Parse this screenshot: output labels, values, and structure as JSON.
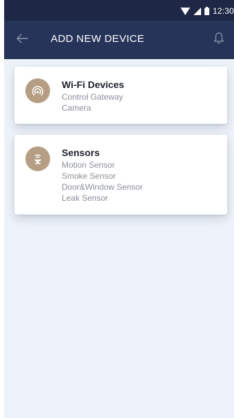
{
  "status_bar": {
    "time": "12:30",
    "icons": [
      "wifi-icon",
      "cell-signal-icon",
      "battery-icon"
    ]
  },
  "app_bar": {
    "title": "ADD NEW DEVICE",
    "left_icon": "arrow-back-icon",
    "right_icon": "bell-icon"
  },
  "categories": [
    {
      "title": "Wi-Fi Devices",
      "icon": "wifi-broadcast-icon",
      "items": [
        "Control Gateway",
        "Camera"
      ]
    },
    {
      "title": "Sensors",
      "icon": "sensor-icon",
      "items": [
        "Motion Sensor",
        "Smoke Sensor",
        "Door&Window Sensor",
        "Leak Sensor"
      ]
    }
  ],
  "colors": {
    "status_bar": "#1e2745",
    "app_bar": "#263459",
    "background": "#eef3f9",
    "icon_circle": "#b59e84",
    "title_text": "#1b1f2a",
    "item_text": "#8a8f98"
  }
}
